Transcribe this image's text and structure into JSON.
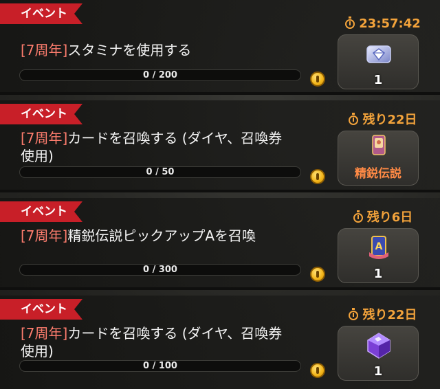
{
  "colors": {
    "tag": "#c81f28",
    "timer": "#f3a33b",
    "prefix": "#ff7d6e",
    "reward_text": "#ff8a45"
  },
  "quests": [
    {
      "tag": "イベント",
      "prefix": "[7周年]",
      "title_rest": "スタミナを使用する",
      "progress_text": "0 / 200",
      "progress": 0,
      "timer": "23:57:42",
      "reward": {
        "icon": "diamond-ticket-icon",
        "qty": "1"
      }
    },
    {
      "tag": "イベント",
      "prefix": "[7周年]",
      "title_rest": "カードを召喚する (ダイヤ、召喚券使用)",
      "progress_text": "0 / 50",
      "progress": 0,
      "timer": "残り22日",
      "reward": {
        "icon": "elite-legend-card-icon",
        "text": "精鋭伝説"
      }
    },
    {
      "tag": "イベント",
      "prefix": "[7周年]",
      "title_rest": "精鋭伝説ピックアップAを召喚",
      "progress_text": "0 / 300",
      "progress": 0,
      "timer": "残り6日",
      "reward": {
        "icon": "pickup-a-ticket-icon",
        "qty": "1"
      }
    },
    {
      "tag": "イベント",
      "prefix": "[7周年]",
      "title_rest": "カードを召喚する (ダイヤ、召喚券使用)",
      "progress_text": "0 / 100",
      "progress": 0,
      "timer": "残り22日",
      "reward": {
        "icon": "purple-crystal-icon",
        "qty": "1"
      }
    }
  ]
}
